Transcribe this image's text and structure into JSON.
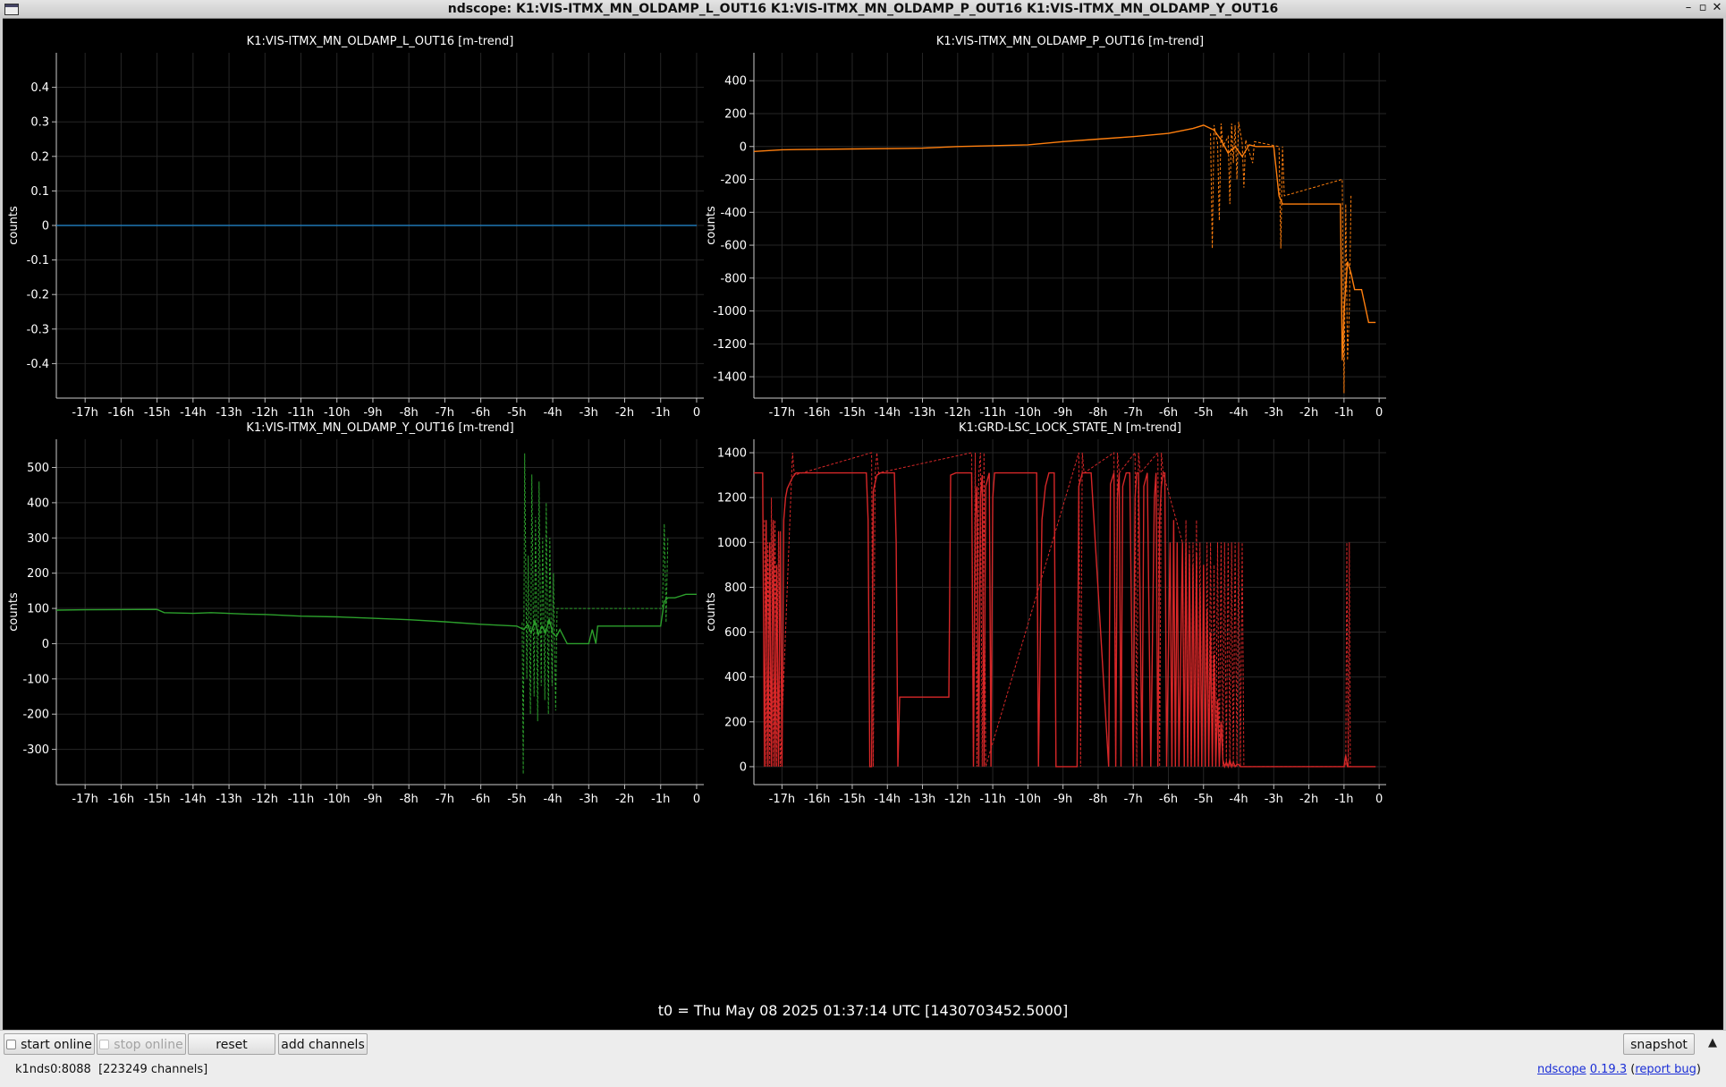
{
  "window": {
    "title": "ndscope: K1:VIS-ITMX_MN_OLDAMP_L_OUT16 K1:VIS-ITMX_MN_OLDAMP_P_OUT16 K1:VIS-ITMX_MN_OLDAMP_Y_OUT16",
    "controls": {
      "minimize": "–",
      "maximize": "▫",
      "close": "✕"
    }
  },
  "t0_label": "t0 = Thu May 08 2025 01:37:14 UTC [1430703452.5000]",
  "toolbar": {
    "start_online": "start online",
    "stop_online": "stop online",
    "reset": "reset",
    "add_channels": "add channels",
    "snapshot": "snapshot",
    "expand_icon": "▲"
  },
  "status": {
    "server": "k1nds0:8088  [223249 channels]"
  },
  "version": {
    "app": "ndscope",
    "version": "0.19.3",
    "report": "report bug"
  },
  "chart_data": [
    {
      "type": "line",
      "title": "K1:VIS-ITMX_MN_OLDAMP_L_OUT16 [m-trend]",
      "ylabel": "counts",
      "xlim": [
        -17.8,
        0.2
      ],
      "ylim": [
        -0.5,
        0.5
      ],
      "x_ticks": [
        "-17h",
        "-16h",
        "-15h",
        "-14h",
        "-13h",
        "-12h",
        "-11h",
        "-10h",
        "-9h",
        "-8h",
        "-7h",
        "-6h",
        "-5h",
        "-4h",
        "-3h",
        "-2h",
        "-1h",
        "0"
      ],
      "y_ticks": [
        0.4,
        0.3,
        0.2,
        0.1,
        0,
        -0.1,
        -0.2,
        -0.3,
        -0.4
      ],
      "y_tick_labels": [
        "0.4",
        "0.3",
        "0.2",
        "0.1",
        "0",
        "-0.1",
        "-0.2",
        "-0.3",
        "-0.4"
      ],
      "color": "#1f77b4",
      "grid": true,
      "series": [
        {
          "x": [
            -17.8,
            0
          ],
          "y": [
            0,
            0
          ]
        }
      ]
    },
    {
      "type": "line",
      "title": "K1:VIS-ITMX_MN_OLDAMP_P_OUT16 [m-trend]",
      "ylabel": "counts",
      "xlim": [
        -17.8,
        0.2
      ],
      "ylim": [
        -1530,
        570
      ],
      "x_ticks": [
        "-17h",
        "-16h",
        "-15h",
        "-14h",
        "-13h",
        "-12h",
        "-11h",
        "-10h",
        "-9h",
        "-8h",
        "-7h",
        "-6h",
        "-5h",
        "-4h",
        "-3h",
        "-2h",
        "-1h",
        "0"
      ],
      "y_ticks": [
        400,
        200,
        0,
        -200,
        -400,
        -600,
        -800,
        -1000,
        -1200,
        -1400
      ],
      "y_tick_labels": [
        "400",
        "200",
        "0",
        "-200",
        "-400",
        "-600",
        "-800",
        "-1000",
        "-1200",
        "-1400"
      ],
      "color": "#ff7f0e",
      "grid": true,
      "series": [
        {
          "x": [
            -17.8,
            -17.0,
            -15.0,
            -13.0,
            -12.0,
            -10.0,
            -9.0,
            -8.0,
            -7.0,
            -6.0,
            -5.3,
            -5.0,
            -4.7,
            -4.5,
            -4.3,
            -4.1,
            -3.9,
            -3.7,
            -3.5,
            -3.0,
            -2.85,
            -2.75,
            -2.0,
            -1.1,
            -1.05,
            -1.0,
            -0.9,
            -0.8,
            -0.7,
            -0.5,
            -0.3,
            -0.1
          ],
          "y": [
            -30,
            -20,
            -15,
            -10,
            0,
            10,
            30,
            45,
            60,
            80,
            110,
            130,
            100,
            40,
            -40,
            0,
            -60,
            10,
            0,
            0,
            -300,
            -350,
            -350,
            -350,
            -1300,
            -1000,
            -700,
            -770,
            -870,
            -870,
            -1070,
            -1070
          ]
        },
        {
          "x": [
            -4.8,
            -4.75,
            -4.7,
            -4.6,
            -4.55,
            -4.5,
            -4.45,
            -4.3,
            -4.25,
            -4.2,
            -4.15,
            -4.1,
            -4.05,
            -4.0,
            -3.9,
            -3.85,
            -3.8,
            -3.6,
            -3.55,
            -2.85,
            -2.8,
            -2.75,
            -2.7,
            -1.05,
            -1.0,
            -0.95,
            -0.9,
            -0.85,
            -0.8
          ],
          "y": [
            80,
            -620,
            130,
            20,
            -450,
            140,
            0,
            60,
            -350,
            140,
            -100,
            130,
            -200,
            150,
            20,
            -250,
            40,
            -100,
            30,
            0,
            -620,
            0,
            -300,
            -200,
            -1500,
            -350,
            -1300,
            -1000,
            -300
          ]
        }
      ]
    },
    {
      "type": "line",
      "title": "K1:VIS-ITMX_MN_OLDAMP_Y_OUT16 [m-trend]",
      "ylabel": "counts",
      "xlim": [
        -17.8,
        0.2
      ],
      "ylim": [
        -400,
        580
      ],
      "x_ticks": [
        "-17h",
        "-16h",
        "-15h",
        "-14h",
        "-13h",
        "-12h",
        "-11h",
        "-10h",
        "-9h",
        "-8h",
        "-7h",
        "-6h",
        "-5h",
        "-4h",
        "-3h",
        "-2h",
        "-1h",
        "0"
      ],
      "y_ticks": [
        500,
        400,
        300,
        200,
        100,
        0,
        -100,
        -200,
        -300
      ],
      "y_tick_labels": [
        "500",
        "400",
        "300",
        "200",
        "100",
        "0",
        "-100",
        "-200",
        "-300"
      ],
      "color": "#2ca02c",
      "grid": true,
      "series": [
        {
          "x": [
            -17.8,
            -17.0,
            -15.0,
            -14.8,
            -14.0,
            -13.5,
            -12.5,
            -12.0,
            -11.0,
            -10.0,
            -9.0,
            -8.0,
            -7.0,
            -6.0,
            -5.0,
            -4.8,
            -4.7,
            -4.6,
            -4.5,
            -4.4,
            -4.3,
            -4.2,
            -4.1,
            -4.0,
            -3.9,
            -3.8,
            -3.6,
            -3.0,
            -2.9,
            -2.8,
            -2.75,
            -2.7,
            -1.2,
            -1.0,
            -0.9,
            -0.8,
            -0.6,
            -0.3,
            -0.1,
            0.0
          ],
          "y": [
            95,
            96,
            97,
            88,
            86,
            88,
            84,
            83,
            78,
            76,
            72,
            68,
            62,
            55,
            50,
            40,
            55,
            30,
            65,
            25,
            50,
            30,
            70,
            30,
            20,
            40,
            0,
            0,
            40,
            0,
            50,
            50,
            50,
            50,
            120,
            130,
            130,
            140,
            140,
            140
          ]
        },
        {
          "x": [
            -4.85,
            -4.82,
            -4.78,
            -4.72,
            -4.68,
            -4.62,
            -4.58,
            -4.52,
            -4.48,
            -4.42,
            -4.38,
            -4.32,
            -4.28,
            -4.22,
            -4.18,
            -4.12,
            -4.08,
            -4.02,
            -3.98,
            -3.92,
            -3.88,
            -0.95,
            -0.9,
            -0.85,
            -0.8
          ],
          "y": [
            60,
            -370,
            540,
            -100,
            250,
            -200,
            480,
            -150,
            360,
            -220,
            460,
            -120,
            300,
            -160,
            400,
            -200,
            300,
            -120,
            200,
            -190,
            100,
            100,
            340,
            60,
            300
          ]
        }
      ]
    },
    {
      "type": "line",
      "title": "K1:GRD-LSC_LOCK_STATE_N [m-trend]",
      "ylabel": "counts",
      "xlim": [
        -17.8,
        0.2
      ],
      "ylim": [
        -80,
        1460
      ],
      "x_ticks": [
        "-17h",
        "-16h",
        "-15h",
        "-14h",
        "-13h",
        "-12h",
        "-11h",
        "-10h",
        "-9h",
        "-8h",
        "-7h",
        "-6h",
        "-5h",
        "-4h",
        "-3h",
        "-2h",
        "-1h",
        "0"
      ],
      "y_ticks": [
        1400,
        1200,
        1000,
        800,
        600,
        400,
        200,
        0
      ],
      "y_tick_labels": [
        "1400",
        "1200",
        "1000",
        "800",
        "600",
        "400",
        "200",
        "0"
      ],
      "color": "#d62728",
      "grid": true,
      "series": [
        {
          "x": [
            -17.8,
            -17.55,
            -17.5,
            -17.45,
            -17.4,
            -17.35,
            -17.3,
            -17.25,
            -17.2,
            -17.15,
            -17.1,
            -17.05,
            -17.0,
            -16.95,
            -16.9,
            -16.85,
            -16.7,
            -16.6,
            -14.6,
            -14.55,
            -14.5,
            -14.45,
            -14.4,
            -14.3,
            -14.2,
            -13.8,
            -13.75,
            -13.7,
            -13.65,
            -13.55,
            -13.5,
            -12.25,
            -12.2,
            -12.05,
            -11.6,
            -11.55,
            -11.5,
            -11.45,
            -11.4,
            -11.35,
            -11.3,
            -11.25,
            -11.2,
            -11.1,
            -11.05,
            -11.0,
            -10.95,
            -10.9,
            -10.85,
            -9.75,
            -9.7,
            -9.6,
            -9.5,
            -9.4,
            -9.25,
            -9.2,
            -8.6,
            -8.55,
            -8.45,
            -8.4,
            -8.3,
            -8.2,
            -7.7,
            -7.65,
            -7.55,
            -7.5,
            -7.45,
            -7.4,
            -7.35,
            -7.3,
            -7.2,
            -7.1,
            -7.0,
            -6.95,
            -6.9,
            -6.85,
            -6.75,
            -6.7,
            -6.6,
            -6.5,
            -6.4,
            -6.35,
            -6.3,
            -6.25,
            -6.2,
            -6.15,
            -6.1,
            -6.05,
            -5.95,
            -5.9,
            -5.85,
            -5.8,
            -5.75,
            -5.7,
            -5.6,
            -5.55,
            -5.5,
            -5.45,
            -5.4,
            -5.35,
            -5.3,
            -5.25,
            -5.2,
            -5.15,
            -5.1,
            -5.05,
            -5.0,
            -4.95,
            -4.9,
            -4.85,
            -4.8,
            -4.75,
            -4.7,
            -4.65,
            -4.6,
            -4.55,
            -4.5,
            -4.45,
            -4.4,
            -4.35,
            -4.3,
            -4.25,
            -4.2,
            -4.15,
            -4.1,
            -4.05,
            -4.0,
            -3.95,
            -3.9,
            -3.85,
            -3.8,
            -1.05,
            -1.0,
            -0.95,
            -0.9,
            -0.85,
            -0.8,
            -0.1
          ],
          "y": [
            1310,
            1310,
            0,
            1100,
            0,
            1000,
            0,
            1100,
            0,
            900,
            0,
            1050,
            0,
            1100,
            1200,
            1240,
            1290,
            1310,
            1310,
            1100,
            0,
            0,
            1230,
            1300,
            1310,
            1310,
            1000,
            0,
            310,
            310,
            310,
            310,
            1300,
            1310,
            1310,
            0,
            1100,
            1250,
            0,
            1200,
            1300,
            0,
            1250,
            1310,
            0,
            1200,
            1310,
            1310,
            1310,
            1310,
            0,
            1100,
            1250,
            1310,
            1310,
            0,
            0,
            1250,
            1310,
            1310,
            1310,
            1310,
            0,
            1260,
            1310,
            0,
            1200,
            1310,
            0,
            1250,
            1310,
            1310,
            0,
            1200,
            1310,
            1310,
            0,
            1250,
            1310,
            0,
            1200,
            1310,
            0,
            1100,
            1250,
            1310,
            1310,
            0,
            1000,
            0,
            1100,
            0,
            1000,
            0,
            1000,
            0,
            1000,
            0,
            950,
            0,
            900,
            0,
            950,
            0,
            800,
            0,
            900,
            0,
            700,
            0,
            600,
            0,
            500,
            0,
            300,
            0,
            200,
            30,
            0,
            20,
            0,
            30,
            0,
            20,
            0,
            10,
            10,
            0,
            0,
            0,
            0,
            0,
            0,
            50,
            0,
            0,
            0,
            0
          ]
        },
        {
          "x": [
            -17.5,
            -17.45,
            -17.4,
            -17.35,
            -17.3,
            -17.25,
            -17.2,
            -17.15,
            -17.1,
            -17.05,
            -16.7,
            -16.65,
            -14.45,
            -14.4,
            -14.35,
            -14.3,
            -14.25,
            -11.6,
            -11.55,
            -11.5,
            -11.45,
            -11.4,
            -11.35,
            -11.3,
            -11.25,
            -11.2,
            -8.55,
            -8.5,
            -8.45,
            -8.4,
            -7.55,
            -7.5,
            -7.45,
            -7.4,
            -6.95,
            -6.9,
            -6.85,
            -6.8,
            -6.3,
            -6.25,
            -6.2,
            -6.15,
            -5.6,
            -5.55,
            -5.5,
            -5.45,
            -5.4,
            -5.35,
            -5.3,
            -5.25,
            -5.2,
            -5.15,
            -5.1,
            -5.05,
            -5.0,
            -4.95,
            -4.9,
            -4.85,
            -4.8,
            -4.75,
            -4.7,
            -4.65,
            -4.6,
            -4.55,
            -4.5,
            -4.45,
            -4.4,
            -4.35,
            -4.3,
            -4.25,
            -4.2,
            -4.15,
            -4.1,
            -4.05,
            -4.0,
            -3.95,
            -3.9,
            -3.85,
            -0.95,
            -0.92,
            -0.88,
            -0.85,
            -0.82
          ],
          "y": [
            1100,
            0,
            1000,
            0,
            1200,
            0,
            1100,
            0,
            1050,
            0,
            1400,
            1300,
            1400,
            0,
            1300,
            1400,
            1310,
            1400,
            0,
            1400,
            0,
            1300,
            1400,
            0,
            1400,
            0,
            1400,
            0,
            1400,
            1310,
            1400,
            0,
            1400,
            1310,
            1400,
            0,
            1400,
            1310,
            1400,
            0,
            1400,
            1310,
            1000,
            0,
            1100,
            0,
            1000,
            0,
            1000,
            0,
            1100,
            0,
            1000,
            0,
            900,
            0,
            1000,
            0,
            1000,
            0,
            900,
            0,
            1000,
            0,
            1000,
            0,
            1000,
            0,
            1000,
            0,
            1000,
            0,
            1000,
            0,
            1000,
            0,
            1000,
            0,
            0,
            1000,
            0,
            1000,
            0
          ]
        }
      ]
    }
  ]
}
